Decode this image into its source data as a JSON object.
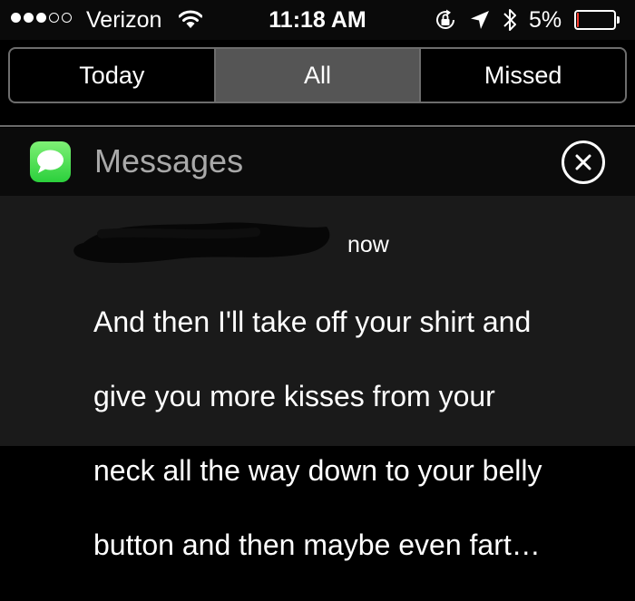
{
  "status_bar": {
    "signal_bars_total": 5,
    "signal_bars_filled": 3,
    "carrier": "Verizon",
    "time": "11:18 AM",
    "battery_percent": "5%",
    "battery_level": 0.05,
    "battery_color": "#ff3b30",
    "icons": [
      "wifi-icon",
      "rotation-lock-icon",
      "location-icon",
      "bluetooth-icon",
      "battery-icon"
    ]
  },
  "tabs": [
    {
      "label": "Today",
      "selected": false
    },
    {
      "label": "All",
      "selected": true
    },
    {
      "label": "Missed",
      "selected": false
    }
  ],
  "notification": {
    "app_name": "Messages",
    "app_icon": "messages-icon",
    "app_icon_color": "#2bd03c",
    "timestamp": "now",
    "message_lines": [
      "And then I'll take off your shirt and",
      "give you more kisses from your",
      "neck all the way down to your belly",
      "button and then maybe even fart…"
    ]
  }
}
